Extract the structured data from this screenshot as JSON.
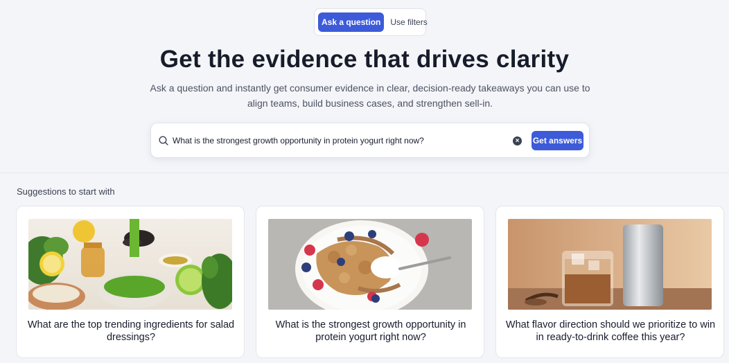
{
  "toggle": {
    "ask_label": "Ask a question",
    "filters_label": "Use filters"
  },
  "hero": {
    "title": "Get the evidence that drives clarity",
    "subtitle": "Ask a question and instantly get consumer evidence in clear, decision-ready takeaways you can use to align teams, build business cases, and strengthen sell-in."
  },
  "search": {
    "value": "What is the strongest growth opportunity in protein yogurt right now?",
    "button_label": "Get answers",
    "icon": "search-icon",
    "clear_icon": "close-icon"
  },
  "suggestions": {
    "title": "Suggestions to start with",
    "cards": [
      {
        "question": "What are the top trending ingredients for salad dressings?"
      },
      {
        "question": "What is the strongest growth opportunity in protein yogurt right now?"
      },
      {
        "question": "What flavor direction should we prioritize to win in ready-to-drink coffee this year?"
      }
    ]
  },
  "colors": {
    "accent": "#3d5bd9",
    "background": "#f4f5f8"
  }
}
